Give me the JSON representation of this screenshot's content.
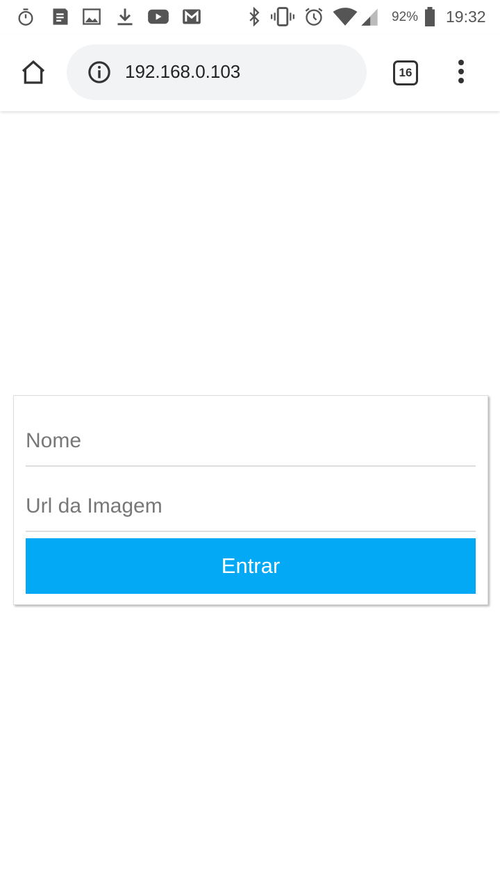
{
  "status_bar": {
    "left_icons": [
      "stopwatch-icon",
      "notes-icon",
      "image-icon",
      "download-icon",
      "youtube-icon",
      "gmail-icon"
    ],
    "right_icons": [
      "bluetooth-icon",
      "vibrate-icon",
      "alarm-icon",
      "wifi-icon",
      "signal-icon",
      "battery-icon"
    ],
    "battery": "92%",
    "time": "19:32"
  },
  "browser": {
    "url": "192.168.0.103",
    "tab_count": "16"
  },
  "form": {
    "name_placeholder": "Nome",
    "image_url_placeholder": "Url da Imagem",
    "submit_label": "Entrar"
  },
  "colors": {
    "accent": "#03a9f4"
  }
}
